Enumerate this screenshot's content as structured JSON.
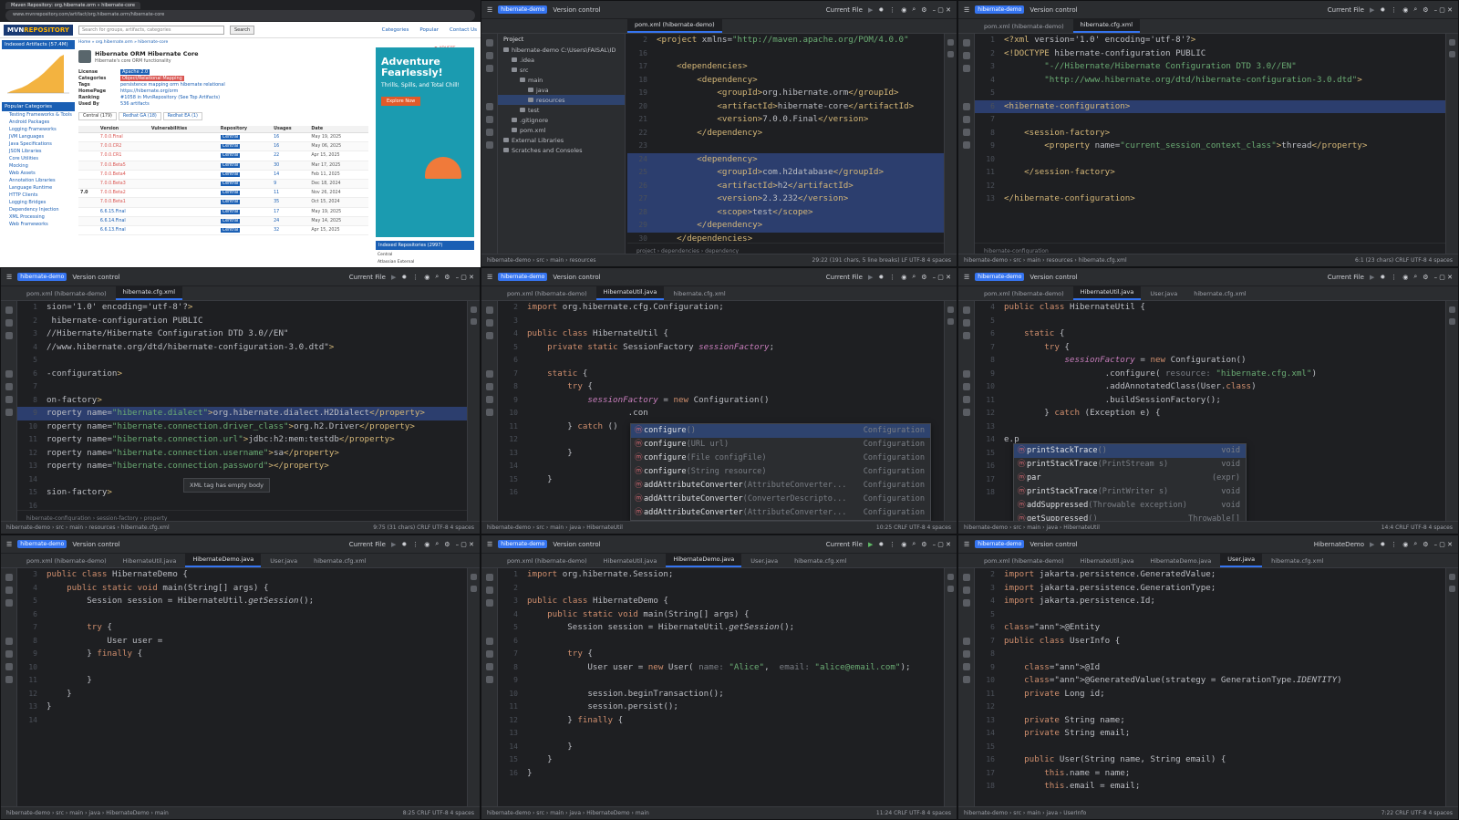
{
  "browser": {
    "tab_title": "Maven Repository: org.hibernate.orm » hibernate-core",
    "url": "www.mvnrepository.com/artifact/org.hibernate.orm/hibernate-core",
    "logo_main": "MVN",
    "logo_accent": "REPOSITORY",
    "search_placeholder": "Search for groups, artifacts, categories",
    "search_button": "Search",
    "nav": [
      "Categories",
      "Popular",
      "Contact Us"
    ],
    "indexed_label": "Indexed Artifacts (57.4M)",
    "popular_categories": "Popular Categories",
    "categories": [
      "Testing Frameworks & Tools",
      "Android Packages",
      "Logging Frameworks",
      "JVM Languages",
      "Java Specifications",
      "JSON Libraries",
      "Core Utilities",
      "Mocking",
      "Web Assets",
      "Annotation Libraries",
      "Language Runtime",
      "HTTP Clients",
      "Logging Bridges",
      "Dependency Injection",
      "XML Processing",
      "Web Frameworks"
    ],
    "breadcrumb": "Home » org.hibernate.orm » hibernate-core",
    "artifact_title": "Hibernate ORM Hibernate Core",
    "artifact_subtitle": "Hibernate's core ORM functionality",
    "info": [
      {
        "k": "License",
        "v": "Apache 2.0"
      },
      {
        "k": "Categories",
        "v": "Object/Relational Mapping"
      },
      {
        "k": "Tags",
        "v": "persistence  mapping  orm  hibernate  relational"
      },
      {
        "k": "HomePage",
        "v": "https://hibernate.org/orm"
      },
      {
        "k": "Ranking",
        "v": "#1058 in MvnRepository (See Top Artifacts)"
      },
      {
        "k": "Used By",
        "v": "536 artifacts"
      }
    ],
    "tabs": [
      "Central (179)",
      "Redhat GA (18)",
      "Redhat EA (1)"
    ],
    "table_headers": [
      "Version",
      "Vulnerabilities",
      "Repository",
      "Usages",
      "Date"
    ],
    "versions": [
      {
        "v": "7.0.0.Final",
        "u": "16",
        "d": "May 19, 2025"
      },
      {
        "v": "7.0.0.CR2",
        "u": "16",
        "d": "May 06, 2025"
      },
      {
        "v": "7.0.0.CR1",
        "u": "22",
        "d": "Apr 15, 2025"
      },
      {
        "v": "7.0.0.Beta5",
        "u": "30",
        "d": "Mar 17, 2025"
      },
      {
        "v": "7.0.0.Beta4",
        "u": "14",
        "d": "Feb 11, 2025"
      },
      {
        "v": "7.0.0.Beta3",
        "u": "9",
        "d": "Dec 18, 2024"
      },
      {
        "v": "7.0.0.Beta2",
        "u": "11",
        "d": "Nov 26, 2024"
      },
      {
        "v": "7.0.0.Beta1",
        "u": "35",
        "d": "Oct 15, 2024"
      },
      {
        "v": "6.6.15.Final",
        "u": "17",
        "d": "May 19, 2025"
      },
      {
        "v": "6.6.14.Final",
        "u": "24",
        "d": "May 14, 2025"
      },
      {
        "v": "6.6.13.Final",
        "u": "32",
        "d": "Apr 15, 2025"
      }
    ],
    "major_label": "7.0",
    "repo_label": "Central",
    "ad_title": "Adventure Fearlessly!",
    "ad_sub": "Thrills, Spills, and Total Chill!",
    "ad_button": "Explore Now",
    "indexed_repos": "Indexed Repositories (2997)",
    "indexed_repo_items": [
      "Central",
      "Atlassian External"
    ]
  },
  "ide": {
    "project": "hibernate-demo",
    "vcs": "Version control",
    "run_config_current": "Current File",
    "run_config_demo": "HibernateDemo"
  },
  "t2": {
    "tab": "pom.xml (hibernate-demo)",
    "project_header": "Project",
    "tree": [
      {
        "t": "hibernate-demo  C:\\Users\\FAISAL\\ID",
        "d": 0
      },
      {
        "t": ".idea",
        "d": 1
      },
      {
        "t": "src",
        "d": 1
      },
      {
        "t": "main",
        "d": 2
      },
      {
        "t": "java",
        "d": 3
      },
      {
        "t": "resources",
        "d": 3,
        "sel": true
      },
      {
        "t": "test",
        "d": 2
      },
      {
        "t": ".gitignore",
        "d": 1
      },
      {
        "t": "pom.xml",
        "d": 1
      },
      {
        "t": "External Libraries",
        "d": 0
      },
      {
        "t": "Scratches and Consoles",
        "d": 0
      }
    ],
    "lines": [
      {
        "n": "2",
        "t": "<project xmlns=\"http://maven.apache.org/POM/4.0.0\""
      },
      {
        "n": "16",
        "t": ""
      },
      {
        "n": "17",
        "t": "    <dependencies>"
      },
      {
        "n": "18",
        "t": "        <dependency>"
      },
      {
        "n": "19",
        "t": "            <groupId>org.hibernate.orm</groupId>"
      },
      {
        "n": "20",
        "t": "            <artifactId>hibernate-core</artifactId>"
      },
      {
        "n": "21",
        "t": "            <version>7.0.0.Final</version>"
      },
      {
        "n": "22",
        "t": "        </dependency>"
      },
      {
        "n": "23",
        "t": ""
      },
      {
        "n": "24",
        "t": "        <dependency>",
        "hl": true
      },
      {
        "n": "25",
        "t": "            <groupId>com.h2database</groupId>",
        "hl": true
      },
      {
        "n": "26",
        "t": "            <artifactId>h2</artifactId>",
        "hl": true
      },
      {
        "n": "27",
        "t": "            <version>2.3.232</version>",
        "hl": true
      },
      {
        "n": "28",
        "t": "            <scope>test</scope>",
        "hl": true
      },
      {
        "n": "29",
        "t": "        </dependency>",
        "hl": true
      },
      {
        "n": "30",
        "t": "    </dependencies>"
      }
    ],
    "crumbs": "project  ›  dependencies  ›  dependency",
    "status": "hibernate-demo  ›  src  ›  main  ›  resources",
    "status_right": "29:22 (191 chars, 5 line breaks)   LF   UTF-8   4 spaces"
  },
  "t3": {
    "tabs": [
      "pom.xml (hibernate-demo)",
      "hibernate.cfg.xml"
    ],
    "lines": [
      {
        "n": "1",
        "t": "<?xml version='1.0' encoding='utf-8'?>"
      },
      {
        "n": "2",
        "t": "<!DOCTYPE hibernate-configuration PUBLIC"
      },
      {
        "n": "3",
        "t": "        \"-//Hibernate/Hibernate Configuration DTD 3.0//EN\""
      },
      {
        "n": "4",
        "t": "        \"http://www.hibernate.org/dtd/hibernate-configuration-3.0.dtd\">"
      },
      {
        "n": "5",
        "t": ""
      },
      {
        "n": "6",
        "t": "<hibernate-configuration>",
        "hl": true
      },
      {
        "n": "7",
        "t": ""
      },
      {
        "n": "8",
        "t": "    <session-factory>"
      },
      {
        "n": "9",
        "t": "        <property name=\"current_session_context_class\">thread</property>"
      },
      {
        "n": "10",
        "t": ""
      },
      {
        "n": "11",
        "t": "    </session-factory>"
      },
      {
        "n": "12",
        "t": ""
      },
      {
        "n": "13",
        "t": "</hibernate-configuration>"
      }
    ],
    "crumbs": "hibernate-configuration",
    "status": "hibernate-demo  ›  src  ›  main  ›  resources  ›  hibernate.cfg.xml",
    "status_right": "6:1 (23 chars)   CRLF   UTF-8   4 spaces"
  },
  "t4": {
    "tabs": [
      "pom.xml (hibernate-demo)",
      "hibernate.cfg.xml"
    ],
    "lines": [
      {
        "n": "1",
        "t": "sion='1.0' encoding='utf-8'?>"
      },
      {
        "n": "2",
        "t": " hibernate-configuration PUBLIC"
      },
      {
        "n": "3",
        "t": "//Hibernate/Hibernate Configuration DTD 3.0//EN\""
      },
      {
        "n": "4",
        "t": "//www.hibernate.org/dtd/hibernate-configuration-3.0.dtd\">"
      },
      {
        "n": "5",
        "t": ""
      },
      {
        "n": "6",
        "t": "-configuration>"
      },
      {
        "n": "7",
        "t": ""
      },
      {
        "n": "8",
        "t": "on-factory>"
      },
      {
        "n": "9",
        "t": "roperty name=\"hibernate.dialect\">org.hibernate.dialect.H2Dialect</property>",
        "hl": true
      },
      {
        "n": "10",
        "t": "roperty name=\"hibernate.connection.driver_class\">org.h2.Driver</property>"
      },
      {
        "n": "11",
        "t": "roperty name=\"hibernate.connection.url\">jdbc:h2:mem:testdb</property>"
      },
      {
        "n": "12",
        "t": "roperty name=\"hibernate.connection.username\">sa</property>"
      },
      {
        "n": "13",
        "t": "roperty name=\"hibernate.connection.password\"></property>"
      },
      {
        "n": "14",
        "t": ""
      },
      {
        "n": "15",
        "t": "sion-factory>"
      },
      {
        "n": "16",
        "t": ""
      }
    ],
    "tooltip": "XML tag has empty body",
    "crumbs": "hibernate-configuration  ›  session-factory  ›  property",
    "status": "hibernate-demo  ›  src  ›  main  ›  resources  ›  hibernate.cfg.xml",
    "status_right": "9:75 (31 chars)   CRLF   UTF-8   4 spaces"
  },
  "t5": {
    "tabs": [
      "pom.xml (hibernate-demo)",
      "HibernateUtil.java",
      "hibernate.cfg.xml"
    ],
    "lines": [
      {
        "n": "2",
        "t": "import org.hibernate.cfg.Configuration;"
      },
      {
        "n": "3",
        "t": ""
      },
      {
        "n": "4",
        "t": "public class HibernateUtil {"
      },
      {
        "n": "5",
        "t": "    private static SessionFactory sessionFactory;"
      },
      {
        "n": "6",
        "t": ""
      },
      {
        "n": "7",
        "t": "    static {"
      },
      {
        "n": "8",
        "t": "        try {"
      },
      {
        "n": "9",
        "t": "            sessionFactory = new Configuration()"
      },
      {
        "n": "10",
        "t": "                    .con"
      },
      {
        "n": "11",
        "t": "        } catch ()"
      },
      {
        "n": "12",
        "t": ""
      },
      {
        "n": "13",
        "t": "        }"
      },
      {
        "n": "14",
        "t": ""
      },
      {
        "n": "15",
        "t": "    }"
      },
      {
        "n": "16",
        "t": ""
      }
    ],
    "completion": [
      {
        "name": "configure",
        "args": "()",
        "ret": "Configuration"
      },
      {
        "name": "configure",
        "args": "(URL url)",
        "ret": "Configuration"
      },
      {
        "name": "configure",
        "args": "(File configFile)",
        "ret": "Configuration"
      },
      {
        "name": "configure",
        "args": "(String resource)",
        "ret": "Configuration"
      },
      {
        "name": "addAttributeConverter",
        "args": "(AttributeConverter...",
        "ret": "Configuration"
      },
      {
        "name": "addAttributeConverter",
        "args": "(ConverterDescripto...",
        "ret": "Configuration"
      },
      {
        "name": "addAttributeConverter",
        "args": "(AttributeConverter...",
        "ret": "Configuration"
      }
    ],
    "status": "hibernate-demo  ›  src  ›  main  ›  java  ›  HibernateUtil",
    "status_right": "10:25   CRLF   UTF-8   4 spaces"
  },
  "t6": {
    "tabs": [
      "pom.xml (hibernate-demo)",
      "HibernateUtil.java",
      "User.java",
      "hibernate.cfg.xml"
    ],
    "lines": [
      {
        "n": "4",
        "t": "public class HibernateUtil {"
      },
      {
        "n": "5",
        "t": ""
      },
      {
        "n": "6",
        "t": "    static {"
      },
      {
        "n": "7",
        "t": "        try {"
      },
      {
        "n": "8",
        "t": "            sessionFactory = new Configuration()"
      },
      {
        "n": "9",
        "t": "                    .configure( resource: \"hibernate.cfg.xml\")"
      },
      {
        "n": "10",
        "t": "                    .addAnnotatedClass(User.class)"
      },
      {
        "n": "11",
        "t": "                    .buildSessionFactory();"
      },
      {
        "n": "12",
        "t": "        } catch (Exception e) {"
      },
      {
        "n": "13",
        "t": ""
      },
      {
        "n": "14",
        "t": "e.p"
      },
      {
        "n": "15",
        "t": ""
      },
      {
        "n": "16",
        "t": ""
      },
      {
        "n": "17",
        "t": ""
      },
      {
        "n": "18",
        "t": ""
      }
    ],
    "completion": [
      {
        "name": "printStackTrace",
        "args": "()",
        "ret": "void"
      },
      {
        "name": "printStackTrace",
        "args": "(PrintStream s)",
        "ret": "void"
      },
      {
        "name": "par",
        "args": "",
        "ret": "(expr)"
      },
      {
        "name": "printStackTrace",
        "args": "(PrintWriter s)",
        "ret": "void"
      },
      {
        "name": "addSuppressed",
        "args": "(Throwable exception)",
        "ret": "void"
      },
      {
        "name": "getSuppressed",
        "args": "()",
        "ret": "Throwable[]"
      }
    ],
    "status": "hibernate-demo  ›  src  ›  main  ›  java  ›  HibernateUtil",
    "status_right": "14:4   CRLF   UTF-8   4 spaces"
  },
  "t7": {
    "tabs": [
      "pom.xml (hibernate-demo)",
      "HibernateUtil.java",
      "HibernateDemo.java",
      "User.java",
      "hibernate.cfg.xml"
    ],
    "lines": [
      {
        "n": "3",
        "t": "public class HibernateDemo {"
      },
      {
        "n": "4",
        "t": "    public static void main(String[] args) {"
      },
      {
        "n": "5",
        "t": "        Session session = HibernateUtil.getSession();"
      },
      {
        "n": "6",
        "t": ""
      },
      {
        "n": "7",
        "t": "        try {"
      },
      {
        "n": "8",
        "t": "            User user = "
      },
      {
        "n": "9",
        "t": "        } finally {"
      },
      {
        "n": "10",
        "t": ""
      },
      {
        "n": "11",
        "t": "        }"
      },
      {
        "n": "12",
        "t": "    }"
      },
      {
        "n": "13",
        "t": "}"
      },
      {
        "n": "14",
        "t": ""
      }
    ],
    "status": "hibernate-demo  ›  src  ›  main  ›  java  ›  HibernateDemo  ›  main",
    "status_right": "8:25   CRLF   UTF-8   4 spaces"
  },
  "t8": {
    "tabs": [
      "pom.xml (hibernate-demo)",
      "HibernateUtil.java",
      "HibernateDemo.java",
      "User.java",
      "hibernate.cfg.xml"
    ],
    "lines": [
      {
        "n": "1",
        "t": "import org.hibernate.Session;"
      },
      {
        "n": "2",
        "t": ""
      },
      {
        "n": "3",
        "t": "public class HibernateDemo {"
      },
      {
        "n": "4",
        "t": "    public static void main(String[] args) {"
      },
      {
        "n": "5",
        "t": "        Session session = HibernateUtil.getSession();"
      },
      {
        "n": "6",
        "t": ""
      },
      {
        "n": "7",
        "t": "        try {"
      },
      {
        "n": "8",
        "t": "            User user = new User( name: \"Alice\",  email: \"alice@email.com\");"
      },
      {
        "n": "9",
        "t": ""
      },
      {
        "n": "10",
        "t": "            session.beginTransaction();"
      },
      {
        "n": "11",
        "t": "            session.persist();"
      },
      {
        "n": "12",
        "t": "        } finally {"
      },
      {
        "n": "13",
        "t": ""
      },
      {
        "n": "14",
        "t": "        }"
      },
      {
        "n": "15",
        "t": "    }"
      },
      {
        "n": "16",
        "t": "}"
      }
    ],
    "status": "hibernate-demo  ›  src  ›  main  ›  java  ›  HibernateDemo  ›  main",
    "status_right": "11:24   CRLF   UTF-8   4 spaces"
  },
  "t9": {
    "tabs": [
      "pom.xml (hibernate-demo)",
      "HibernateUtil.java",
      "HibernateDemo.java",
      "User.java",
      "hibernate.cfg.xml"
    ],
    "lines": [
      {
        "n": "2",
        "t": "import jakarta.persistence.GeneratedValue;"
      },
      {
        "n": "3",
        "t": "import jakarta.persistence.GenerationType;"
      },
      {
        "n": "4",
        "t": "import jakarta.persistence.Id;"
      },
      {
        "n": "5",
        "t": ""
      },
      {
        "n": "6",
        "t": "@Entity"
      },
      {
        "n": "7",
        "t": "public class UserInfo {"
      },
      {
        "n": "8",
        "t": ""
      },
      {
        "n": "9",
        "t": "    @Id"
      },
      {
        "n": "10",
        "t": "    @GeneratedValue(strategy = GenerationType.IDENTITY)"
      },
      {
        "n": "11",
        "t": "    private Long id;"
      },
      {
        "n": "12",
        "t": ""
      },
      {
        "n": "13",
        "t": "    private String name;"
      },
      {
        "n": "14",
        "t": "    private String email;"
      },
      {
        "n": "15",
        "t": ""
      },
      {
        "n": "16",
        "t": "    public User(String name, String email) {"
      },
      {
        "n": "17",
        "t": "        this.name = name;"
      },
      {
        "n": "18",
        "t": "        this.email = email;"
      }
    ],
    "status": "hibernate-demo  ›  src  ›  main  ›  java  ›  UserInfo",
    "status_right": "7:22   CRLF   UTF-8   4 spaces"
  }
}
